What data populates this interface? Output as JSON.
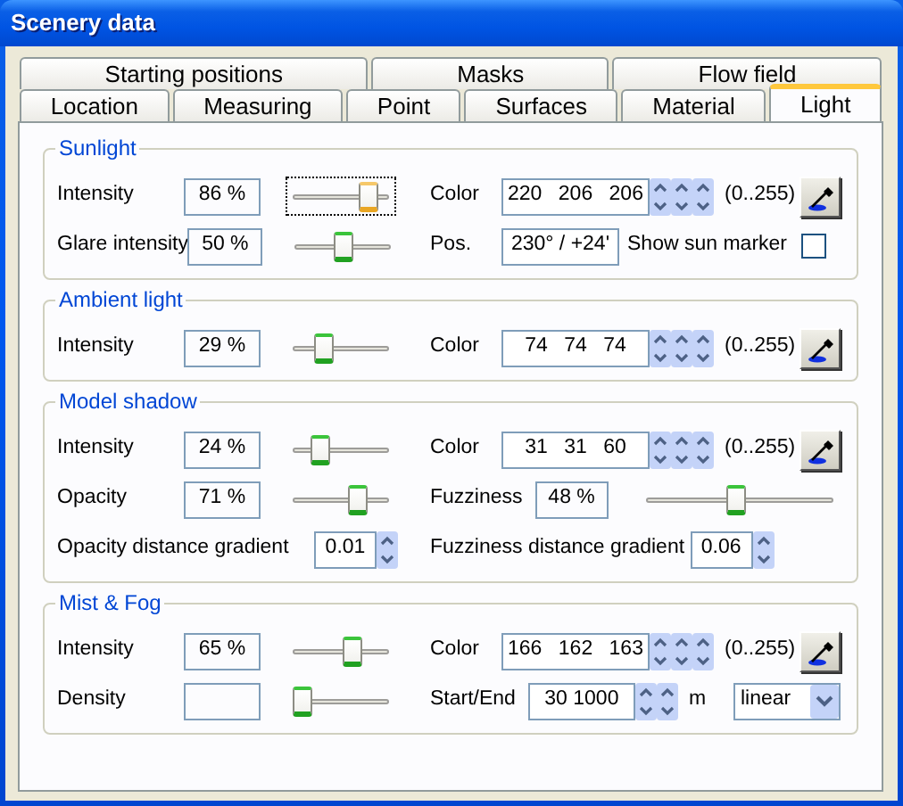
{
  "window": {
    "title": "Scenery data"
  },
  "tab_rows": [
    [
      {
        "label": "Starting positions",
        "selected": false
      },
      {
        "label": "Masks",
        "selected": false
      },
      {
        "label": "Flow field",
        "selected": false
      }
    ],
    [
      {
        "label": "Location",
        "selected": false
      },
      {
        "label": "Measuring",
        "selected": false
      },
      {
        "label": "Point",
        "selected": false
      },
      {
        "label": "Surfaces",
        "selected": false
      },
      {
        "label": "Material",
        "selected": false
      },
      {
        "label": "Light",
        "selected": true
      }
    ]
  ],
  "groups": [
    {
      "title": "Sunlight",
      "rows": [
        {
          "left": [
            {
              "kind": "label",
              "text": "Intensity"
            },
            {
              "kind": "value",
              "text": "86 %"
            },
            {
              "kind": "slider",
              "level": 0.86,
              "focused": true
            }
          ],
          "right": [
            {
              "kind": "label",
              "text": "Color"
            },
            {
              "kind": "color",
              "text": "220 206 206"
            },
            {
              "kind": "range",
              "text": "(0..255)"
            },
            {
              "kind": "picker"
            }
          ]
        },
        {
          "left": [
            {
              "kind": "label",
              "text": "Glare intensity"
            },
            {
              "kind": "value",
              "text": "50 %"
            },
            {
              "kind": "slider",
              "level": 0.5,
              "focused": false
            }
          ],
          "right": [
            {
              "kind": "label",
              "text": "Pos."
            },
            {
              "kind": "field",
              "text": "230° / +24'"
            },
            {
              "kind": "checkbox",
              "text": "Show sun marker",
              "checked": false
            }
          ]
        }
      ]
    },
    {
      "title": "Ambient light",
      "rows": [
        {
          "left": [
            {
              "kind": "label",
              "text": "Intensity"
            },
            {
              "kind": "value",
              "text": "29 %"
            },
            {
              "kind": "slider",
              "level": 0.29,
              "focused": false
            }
          ],
          "right": [
            {
              "kind": "label",
              "text": "Color"
            },
            {
              "kind": "color",
              "text": "74 74 74"
            },
            {
              "kind": "range",
              "text": "(0..255)"
            },
            {
              "kind": "picker"
            }
          ]
        }
      ]
    },
    {
      "title": "Model shadow",
      "rows": [
        {
          "left": [
            {
              "kind": "label",
              "text": "Intensity"
            },
            {
              "kind": "value",
              "text": "24 %"
            },
            {
              "kind": "slider",
              "level": 0.24,
              "focused": false
            }
          ],
          "right": [
            {
              "kind": "label",
              "text": "Color"
            },
            {
              "kind": "color",
              "text": "31 31 60"
            },
            {
              "kind": "range",
              "text": "(0..255)"
            },
            {
              "kind": "picker"
            }
          ]
        },
        {
          "left": [
            {
              "kind": "label",
              "text": "Opacity"
            },
            {
              "kind": "value",
              "text": "71 %"
            },
            {
              "kind": "slider",
              "level": 0.71,
              "focused": false
            }
          ],
          "right": [
            {
              "kind": "label",
              "text": "Fuzziness"
            },
            {
              "kind": "value",
              "text": "48 %"
            },
            {
              "kind": "slider",
              "level": 0.48,
              "focused": false
            }
          ]
        },
        {
          "left": [
            {
              "kind": "label",
              "text": "Opacity distance gradient"
            },
            {
              "kind": "spin_field",
              "text": "0.01"
            }
          ],
          "right": [
            {
              "kind": "label",
              "text": "Fuzziness distance gradient"
            },
            {
              "kind": "spin_field",
              "text": "0.06"
            }
          ]
        }
      ]
    },
    {
      "title": "Mist & Fog",
      "rows": [
        {
          "left": [
            {
              "kind": "label",
              "text": "Intensity"
            },
            {
              "kind": "value",
              "text": "65 %"
            },
            {
              "kind": "slider",
              "level": 0.65,
              "focused": false
            }
          ],
          "right": [
            {
              "kind": "label",
              "text": "Color"
            },
            {
              "kind": "color",
              "text": "166 162 163"
            },
            {
              "kind": "range",
              "text": "(0..255)"
            },
            {
              "kind": "picker"
            }
          ]
        },
        {
          "left": [
            {
              "kind": "label",
              "text": "Density"
            },
            {
              "kind": "value"
            },
            {
              "kind": "slider",
              "level": 0,
              "focused": false
            }
          ],
          "right": [
            {
              "kind": "label",
              "text": "Start/End"
            },
            {
              "kind": "pair_field",
              "text": "30 1000"
            },
            {
              "kind": "unit",
              "text": "m"
            },
            {
              "kind": "select",
              "text": "linear"
            }
          ]
        }
      ]
    }
  ]
}
